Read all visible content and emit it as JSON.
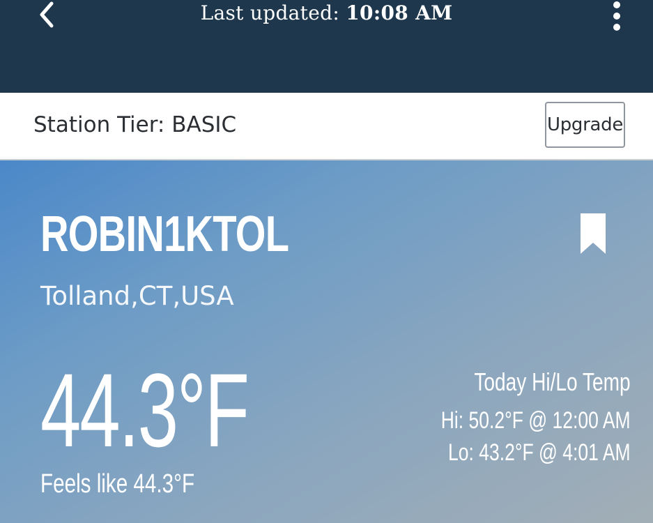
{
  "header": {
    "back_icon": "chevron-left-icon",
    "updated_label": "Last updated:",
    "updated_time": "10:08 AM",
    "more_icon": "vertical-dots-icon",
    "background_color": "#1e374c"
  },
  "tier": {
    "label": "Station Tier: BASIC",
    "upgrade_button": "Upgrade"
  },
  "station": {
    "id": "ROBIN1KTOL",
    "location": "Tolland,CT,USA",
    "bookmark_icon": "bookmark-icon",
    "current_temp": "44.3°F",
    "feels_like": "Feels like 44.3°F",
    "hilo_title": "Today Hi/Lo Temp",
    "hi": "Hi: 50.2°F @ 12:00 AM",
    "lo": "Lo: 43.2°F @ 4:01 AM"
  }
}
